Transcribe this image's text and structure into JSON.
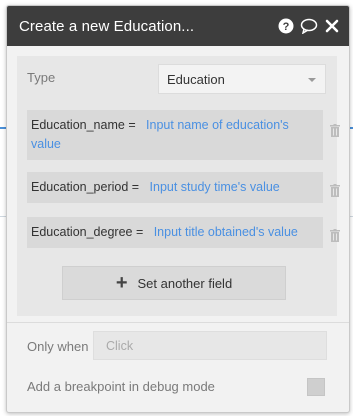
{
  "dialog": {
    "title": "Create a new Education...",
    "icons": [
      "help-icon",
      "comment-icon",
      "close-icon"
    ]
  },
  "type_row": {
    "label": "Type",
    "selected": "Education"
  },
  "fields": [
    {
      "name": "Education_name",
      "op": "=",
      "value": "Input name of education's value"
    },
    {
      "name": "Education_period",
      "op": "=",
      "value": "Input study time's value"
    },
    {
      "name": "Education_degree",
      "op": "=",
      "value": "Input title obtained's value"
    }
  ],
  "add_field_label": "Set another field",
  "only_when": {
    "label": "Only when",
    "placeholder": "Click"
  },
  "breakpoint": {
    "label": "Add a breakpoint in debug mode"
  },
  "colors": {
    "titlebar": "#3d3d3d",
    "accent": "#4a90e2"
  }
}
